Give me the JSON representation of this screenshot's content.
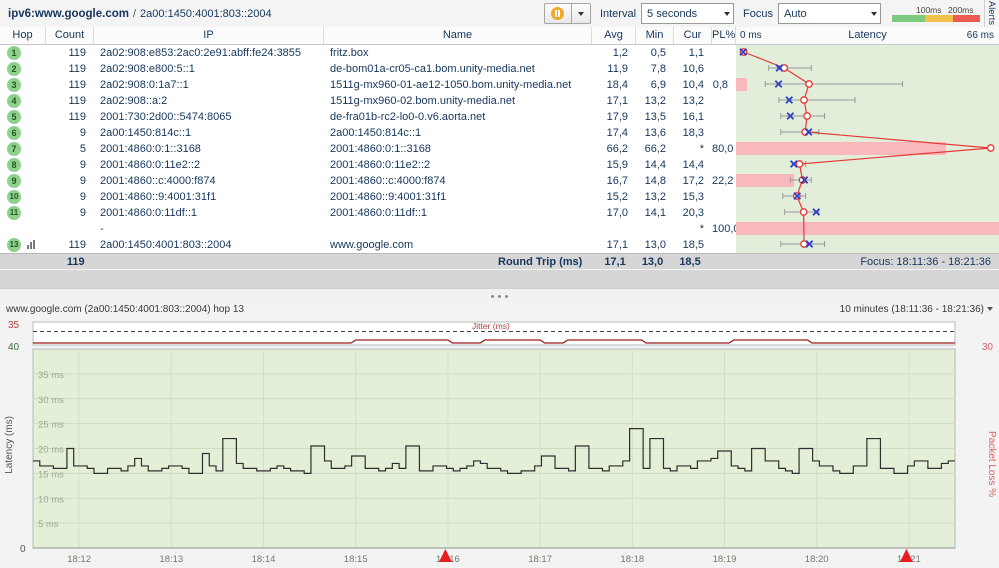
{
  "window": {
    "title_main": "ipv6:www.google.com",
    "title_sep": "/",
    "title_sub": "2a00:1450:4001:803::2004"
  },
  "toolbar": {
    "pause_icon": "pause-icon",
    "pause_dropdown_icon": "chevron-down-icon",
    "interval_label": "Interval",
    "interval_value": "5 seconds",
    "focus_label": "Focus",
    "focus_value": "Auto",
    "legend_tick_100": "100ms",
    "legend_tick_200": "200ms",
    "legend_colors": [
      "#7dc97d",
      "#f2c14b",
      "#ec5b52"
    ],
    "alerts_tab": "Alerts"
  },
  "table": {
    "columns": [
      "Hop",
      "Count",
      "IP",
      "Name",
      "Avg",
      "Min",
      "Cur",
      "PL%"
    ],
    "latency_header": {
      "min_label": "0 ms",
      "title": "Latency",
      "max_label": "66 ms"
    },
    "rows": [
      {
        "hop": "1",
        "count": "119",
        "ip": "2a02:908:e853:2ac0:2e91:abff:fe24:3855",
        "name": "fritz.box",
        "avg": "1,2",
        "min": "0,5",
        "cur": "1,1",
        "pl": ""
      },
      {
        "hop": "2",
        "count": "119",
        "ip": "2a02:908:e800:5::1",
        "name": "de-bom01a-cr05-ca1.bom.unity-media.net",
        "avg": "11,9",
        "min": "7,8",
        "cur": "10,6",
        "pl": ""
      },
      {
        "hop": "3",
        "count": "119",
        "ip": "2a02:908:0:1a7::1",
        "name": "1511g-mx960-01-ae12-1050.bom.unity-media.net",
        "avg": "18,4",
        "min": "6,9",
        "cur": "10,4",
        "pl": "0,8"
      },
      {
        "hop": "4",
        "count": "119",
        "ip": "2a02:908::a:2",
        "name": "1511g-mx960-02.bom.unity-media.net",
        "avg": "17,1",
        "min": "13,2",
        "cur": "13,2",
        "pl": ""
      },
      {
        "hop": "5",
        "count": "119",
        "ip": "2001:730:2d00::5474:8065",
        "name": "de-fra01b-rc2-lo0-0.v6.aorta.net",
        "avg": "17,9",
        "min": "13,5",
        "cur": "16,1",
        "pl": ""
      },
      {
        "hop": "6",
        "count": "9",
        "ip": "2a00:1450:814c::1",
        "name": "2a00:1450:814c::1",
        "avg": "17,4",
        "min": "13,6",
        "cur": "18,3",
        "pl": ""
      },
      {
        "hop": "7",
        "count": "5",
        "ip": "2001:4860:0:1::3168",
        "name": "2001:4860:0:1::3168",
        "avg": "66,2",
        "min": "66,2",
        "cur": "*",
        "pl": "80,0"
      },
      {
        "hop": "8",
        "count": "9",
        "ip": "2001:4860:0:11e2::2",
        "name": "2001:4860:0:11e2::2",
        "avg": "15,9",
        "min": "14,4",
        "cur": "14,4",
        "pl": ""
      },
      {
        "hop": "9",
        "count": "9",
        "ip": "2001:4860::c:4000:f874",
        "name": "2001:4860::c:4000:f874",
        "avg": "16,7",
        "min": "14,8",
        "cur": "17,2",
        "pl": "22,2"
      },
      {
        "hop": "10",
        "count": "9",
        "ip": "2001:4860::9:4001:31f1",
        "name": "2001:4860::9:4001:31f1",
        "avg": "15,2",
        "min": "13,2",
        "cur": "15,3",
        "pl": ""
      },
      {
        "hop": "11",
        "count": "9",
        "ip": "2001:4860:0:11df::1",
        "name": "2001:4860:0:11df::1",
        "avg": "17,0",
        "min": "14,1",
        "cur": "20,3",
        "pl": ""
      },
      {
        "hop": "",
        "count": "",
        "ip": "-",
        "name": "",
        "avg": "",
        "min": "",
        "cur": "*",
        "pl": "100,0"
      },
      {
        "hop": "13",
        "count": "119",
        "ip": "2a00:1450:4001:803::2004",
        "name": "www.google.com",
        "avg": "17,1",
        "min": "13,0",
        "cur": "18,5",
        "pl": ""
      }
    ],
    "total": {
      "count": "119",
      "label": "Round Trip (ms)",
      "avg": "17,1",
      "min": "13,0",
      "cur": "18,5",
      "focus": "Focus: 18:11:36 - 18:21:36"
    }
  },
  "chart": {
    "header_left": "www.google.com (2a00:1450:4001:803::2004) hop 13",
    "header_right": "10 minutes (18:11:36 - 18:21:36)",
    "header_dropdown_icon": "chevron-down-icon"
  },
  "chart_data": {
    "type": "line",
    "title": "www.google.com (2a00:1450:4001:803::2004) hop 13",
    "xlabel": "",
    "ylabel": "Latency (ms)",
    "y2label": "Packet Loss %",
    "jitter_label": "Jitter (ms)",
    "jitter_axis_max": "35",
    "latency_axis_max": "40",
    "packetloss_axis_max": "30",
    "ylim": [
      0,
      40
    ],
    "ytick_labels": [
      "5 ms",
      "10 ms",
      "15 ms",
      "20 ms",
      "25 ms",
      "30 ms",
      "35 ms"
    ],
    "ytick_values": [
      5,
      10,
      15,
      20,
      25,
      30,
      35
    ],
    "y_bottom_label": "0",
    "xtick_labels": [
      "18:12",
      "18:13",
      "18:14",
      "18:15",
      "18:16",
      "18:17",
      "18:18",
      "18:19",
      "18:20",
      "18:21"
    ],
    "alert_markers": [
      "18:16",
      "18:21"
    ],
    "grid": true,
    "legend": "none",
    "series": [
      {
        "name": "Latency (ms)",
        "color": "#3a3a3a",
        "values": [
          17.5,
          16.5,
          16.5,
          16.0,
          16.0,
          20.0,
          16.5,
          16.5,
          16.0,
          15.0,
          15.0,
          16.0,
          16.0,
          15.5,
          16.5,
          18.0,
          16.5,
          15.5,
          15.5,
          16.0,
          16.5,
          16.5,
          16.0,
          15.0,
          15.0,
          19.0,
          16.5,
          15.5,
          22.0,
          22.0,
          17.0,
          16.0,
          16.0,
          15.5,
          15.5,
          16.0,
          16.5,
          16.0,
          15.5,
          15.5,
          15.0,
          20.5,
          20.5,
          17.5,
          16.0,
          16.0,
          16.5,
          18.5,
          18.5,
          16.0,
          16.0,
          15.5,
          16.0,
          17.0,
          16.0,
          20.5,
          20.5,
          15.5,
          15.5,
          16.5,
          16.5,
          16.0,
          15.5,
          16.0,
          16.5,
          17.5,
          17.0,
          16.0,
          16.0,
          15.5,
          15.0,
          15.0,
          15.5,
          15.5,
          16.5,
          18.5,
          18.5,
          16.0,
          16.0,
          15.5,
          20.5,
          20.5,
          16.0,
          16.0,
          15.5,
          16.5,
          16.5,
          17.5,
          24.0,
          24.0,
          16.0,
          22.0,
          22.0,
          16.0,
          15.5,
          16.5,
          16.5,
          16.0,
          17.5,
          17.5,
          18.0,
          19.5,
          19.5,
          16.5,
          16.0,
          15.5,
          20.0,
          20.0,
          17.5,
          17.5,
          16.0,
          15.5,
          15.0,
          20.0,
          20.0,
          17.5,
          16.5,
          16.5,
          15.5,
          15.0,
          15.0,
          16.5,
          16.5,
          22.0,
          22.0,
          16.0,
          16.0,
          15.0,
          15.0,
          16.5,
          17.5,
          17.5,
          16.0,
          16.0,
          17.0,
          17.5
        ]
      },
      {
        "name": "Jitter (ms)",
        "color": "#b04040",
        "values": [
          0,
          0,
          0,
          0,
          0,
          0,
          0,
          0,
          0,
          0,
          0,
          0,
          0,
          0,
          0,
          0,
          0,
          0,
          0,
          0,
          0,
          0,
          0,
          0,
          0,
          0,
          0,
          0,
          0,
          0,
          0,
          0,
          0,
          0,
          0,
          0,
          0,
          0,
          0,
          0,
          0,
          0,
          0,
          0,
          0,
          0,
          0,
          0,
          0,
          0,
          0,
          0,
          0,
          0,
          0,
          0,
          0,
          0,
          0,
          0,
          0,
          0,
          0,
          0,
          0,
          0,
          0,
          0,
          0,
          0,
          0,
          0,
          0,
          0,
          0,
          0,
          0,
          0,
          0,
          0
        ]
      }
    ]
  },
  "latency_plot": {
    "scale_min": 0,
    "scale_max": 66,
    "points": [
      {
        "hop": 1,
        "avg": 1.2,
        "min": 0.5,
        "max": 2.0,
        "cur": 1.1,
        "pl": 0
      },
      {
        "hop": 2,
        "avg": 11.9,
        "min": 7.8,
        "max": 19.0,
        "cur": 10.6,
        "pl": 0
      },
      {
        "hop": 3,
        "avg": 18.4,
        "min": 6.9,
        "max": 43.0,
        "cur": 10.4,
        "pl": 0.8
      },
      {
        "hop": 4,
        "avg": 17.1,
        "min": 10.5,
        "max": 30.5,
        "cur": 13.2,
        "pl": 0
      },
      {
        "hop": 5,
        "avg": 17.9,
        "min": 11.0,
        "max": 22.5,
        "cur": 13.5,
        "pl": 0
      },
      {
        "hop": 6,
        "avg": 17.4,
        "min": 11.0,
        "max": 21.0,
        "cur": 18.3,
        "pl": 0
      },
      {
        "hop": 7,
        "avg": 66.2,
        "min": 66.2,
        "max": 66.2,
        "cur": 0,
        "pl": 80.0
      },
      {
        "hop": 8,
        "avg": 15.9,
        "min": 14.0,
        "max": 17.5,
        "cur": 14.4,
        "pl": 0
      },
      {
        "hop": 9,
        "avg": 16.7,
        "min": 13.5,
        "max": 19.0,
        "cur": 17.2,
        "pl": 22.2
      },
      {
        "hop": 10,
        "avg": 15.2,
        "min": 11.5,
        "max": 17.5,
        "cur": 15.3,
        "pl": 0
      },
      {
        "hop": 11,
        "avg": 17.0,
        "min": 12.0,
        "max": 21.0,
        "cur": 20.3,
        "pl": 0
      },
      {
        "hop": 13,
        "avg": 17.1,
        "min": 11.0,
        "max": 22.5,
        "cur": 18.5,
        "pl": 0
      }
    ]
  }
}
